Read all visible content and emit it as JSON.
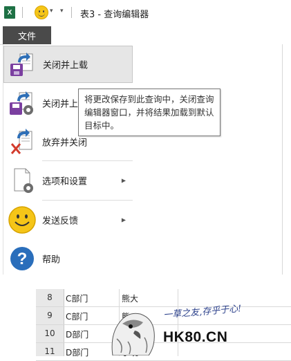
{
  "titlebar": {
    "app_icon": "excel-icon",
    "app_icon_letter": "X",
    "feedback_icon": "smiley-icon",
    "title": "表3 - 查询编辑器"
  },
  "file_tab": {
    "label": "文件"
  },
  "menu": {
    "items": [
      {
        "label": "关闭并上载",
        "icon": "close-and-load-icon",
        "selected": true,
        "has_submenu": false
      },
      {
        "label": "关闭并上载至...",
        "icon": "close-and-load-to-icon",
        "selected": false,
        "has_submenu": false
      },
      {
        "label": "放弃并关闭",
        "icon": "discard-and-close-icon",
        "selected": false,
        "has_submenu": false
      },
      {
        "label": "选项和设置",
        "icon": "options-settings-icon",
        "selected": false,
        "has_submenu": true
      },
      {
        "label": "发送反馈",
        "icon": "smiley-icon",
        "selected": false,
        "has_submenu": true
      },
      {
        "label": "帮助",
        "icon": "help-icon",
        "selected": false,
        "has_submenu": false
      }
    ]
  },
  "tooltip": {
    "text": "将更改保存到此查询中，关闭查询编辑器窗口，并将结果加载到默认目标中。"
  },
  "sheet": {
    "rows": [
      {
        "num": "8",
        "dept": "C部门",
        "name": "熊大"
      },
      {
        "num": "9",
        "dept": "C部门",
        "name": "熊二"
      },
      {
        "num": "10",
        "dept": "D部门",
        "name": ""
      },
      {
        "num": "11",
        "dept": "D部门",
        "name": "于晓"
      }
    ]
  },
  "watermark": {
    "slogan": "一草之友,存乎于心!",
    "brand": "HK80.CN"
  },
  "colors": {
    "excel_green": "#1e7145",
    "file_tab_bg": "#4a4a4a",
    "selected_item_bg": "#e6e6e6",
    "help_blue": "#2a6ebb",
    "smiley_yellow": "#f5c518"
  }
}
